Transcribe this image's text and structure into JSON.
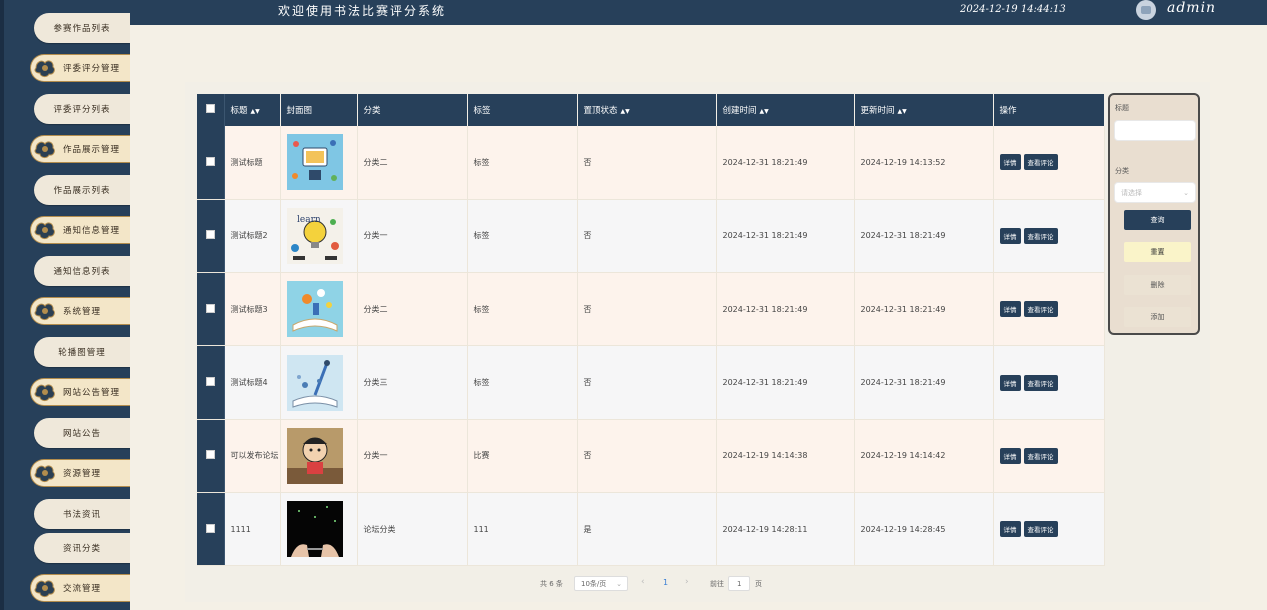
{
  "header": {
    "title": "欢迎使用书法比赛评分系统",
    "datetime": "2024-12-19 14:44:13",
    "user": "admin"
  },
  "sidebar": {
    "items": [
      {
        "label": "参赛作品列表",
        "type": "sub"
      },
      {
        "label": "评委评分管理",
        "type": "main"
      },
      {
        "label": "评委评分列表",
        "type": "sub"
      },
      {
        "label": "作品展示管理",
        "type": "main"
      },
      {
        "label": "作品展示列表",
        "type": "sub"
      },
      {
        "label": "通知信息管理",
        "type": "main"
      },
      {
        "label": "通知信息列表",
        "type": "sub"
      },
      {
        "label": "系统管理",
        "type": "main"
      },
      {
        "label": "轮播图管理",
        "type": "sub"
      },
      {
        "label": "网站公告管理",
        "type": "main"
      },
      {
        "label": "网站公告",
        "type": "sub"
      },
      {
        "label": "资源管理",
        "type": "main"
      },
      {
        "label": "书法资讯",
        "type": "sub"
      },
      {
        "label": "资讯分类",
        "type": "sub"
      },
      {
        "label": "交流管理",
        "type": "main"
      }
    ]
  },
  "table": {
    "columns": {
      "title": "标题",
      "cover": "封面图",
      "category": "分类",
      "tag": "标签",
      "pinned": "置顶状态",
      "created": "创建时间",
      "updated": "更新时间",
      "actions": "操作"
    },
    "rows": [
      {
        "title": "测试标题",
        "category": "分类二",
        "tag": "标签",
        "pinned": "否",
        "created": "2024-12-31 18:21:49",
        "updated": "2024-12-19 14:13:52"
      },
      {
        "title": "测试标题2",
        "category": "分类一",
        "tag": "标签",
        "pinned": "否",
        "created": "2024-12-31 18:21:49",
        "updated": "2024-12-31 18:21:49"
      },
      {
        "title": "测试标题3",
        "category": "分类二",
        "tag": "标签",
        "pinned": "否",
        "created": "2024-12-31 18:21:49",
        "updated": "2024-12-31 18:21:49"
      },
      {
        "title": "测试标题4",
        "category": "分类三",
        "tag": "标签",
        "pinned": "否",
        "created": "2024-12-31 18:21:49",
        "updated": "2024-12-31 18:21:49"
      },
      {
        "title": "可以发布论坛",
        "category": "分类一",
        "tag": "比赛",
        "pinned": "否",
        "created": "2024-12-19 14:14:38",
        "updated": "2024-12-19 14:14:42"
      },
      {
        "title": "1111",
        "category": "论坛分类",
        "tag": "111",
        "pinned": "是",
        "created": "2024-12-19 14:28:11",
        "updated": "2024-12-19 14:28:45"
      }
    ],
    "detail_label": "详情",
    "comments_label": "查看评论"
  },
  "pagination": {
    "total": "共 6 条",
    "page_size": "10条/页",
    "prev": "‹",
    "current_page": "1",
    "next": "›",
    "goto_prefix": "前往",
    "goto_value": "1",
    "goto_suffix": "页"
  },
  "search": {
    "title_label": "标题",
    "title_value": "",
    "category_label": "分类",
    "category_placeholder": "请选择",
    "query_button": "查询",
    "reset_button": "重置",
    "delete_button": "删除",
    "add_button": "添加"
  },
  "colors": {
    "navy": "#27405a",
    "background": "#f4f0e6",
    "row_odd": "#fdf3ec",
    "row_even": "#f6f6f7",
    "reset_button": "#faf4c9"
  }
}
